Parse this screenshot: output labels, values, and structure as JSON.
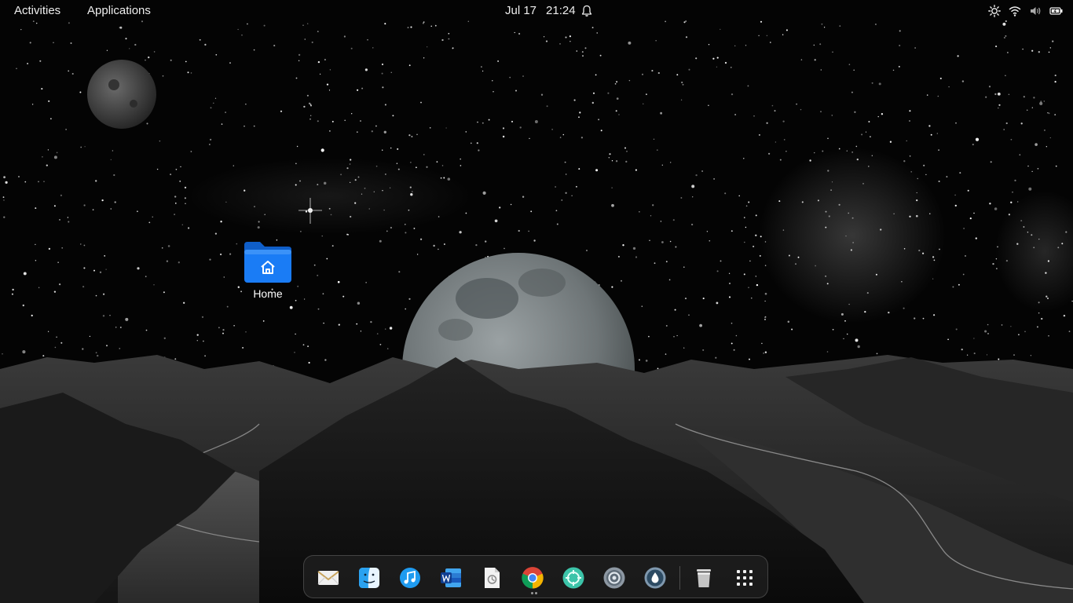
{
  "top_bar": {
    "activities": "Activities",
    "applications": "Applications",
    "date": "Jul 17",
    "time": "21:24",
    "icons": [
      "bell-icon",
      "brightness-icon",
      "wifi-icon",
      "volume-icon",
      "battery-icon"
    ]
  },
  "desktop": {
    "icons": [
      {
        "label": "Home",
        "icon": "home-folder-icon"
      }
    ]
  },
  "dock": {
    "items": [
      {
        "name": "mail",
        "icon": "mail-icon",
        "running": false
      },
      {
        "name": "finder",
        "icon": "finder-icon",
        "running": false
      },
      {
        "name": "music",
        "icon": "music-icon",
        "running": false
      },
      {
        "name": "word",
        "icon": "word-icon",
        "running": false
      },
      {
        "name": "document-viewer",
        "icon": "document-viewer-icon",
        "running": false
      },
      {
        "name": "chrome",
        "icon": "chrome-icon",
        "running": true
      },
      {
        "name": "remote-connect",
        "icon": "remote-connect-icon",
        "running": false
      },
      {
        "name": "settings",
        "icon": "settings-icon",
        "running": false
      },
      {
        "name": "droplet-app",
        "icon": "droplet-icon",
        "running": false
      },
      {
        "name": "trash",
        "icon": "trash-icon",
        "running": false
      },
      {
        "name": "show-applications",
        "icon": "app-grid-icon",
        "running": false
      }
    ]
  },
  "colors": {
    "folder_blue": "#1a7cf5",
    "top_bar_text": "#eeeeee",
    "dock_background": "#1c1c1c"
  }
}
